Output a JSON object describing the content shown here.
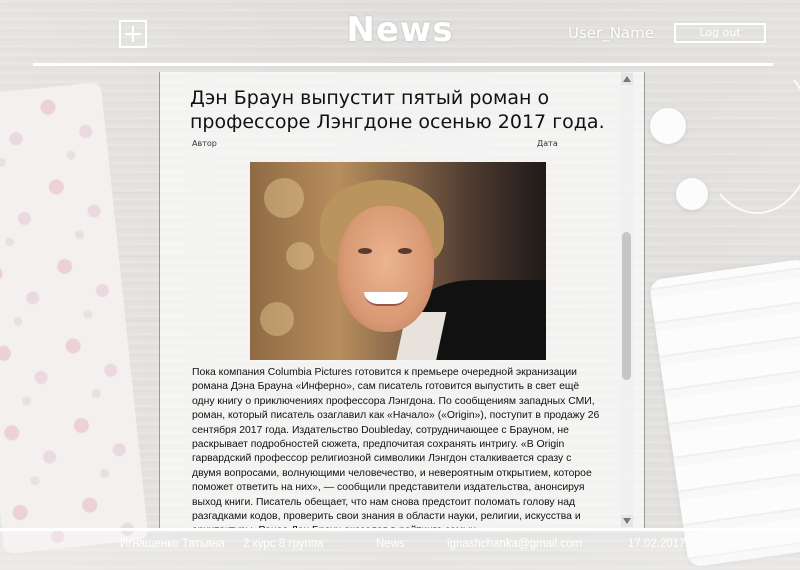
{
  "header": {
    "title": "News",
    "user_name": "User_Name",
    "logout_label": "Log out",
    "add_icon": "plus-square-icon"
  },
  "article": {
    "headline": "Дэн Браун выпустит пятый роман о профессоре Лэнгдоне осенью 2017 года.",
    "author_label": "Автор",
    "date_label": "Дата",
    "body": "Пока компания Columbia Pictures готовится к премьере очередной экранизации романа Дэна Брауна «Инферно», сам писатель готовится выпустить в свет ещё одну книгу о приключениях профессора Лэнгдона. По сообщениям западных СМИ, роман, который писатель озаглавил как «Начало» («Origin»), поступит в продажу 26 сентября 2017 года. Издательство Doubleday, сотрудничающее с Брауном, не раскрывает подробностей сюжета, предпочитая сохранять интригу. «В Origin гарвардский профессор религиозной символики Лэнгдон сталкивается сразу с двумя вопросами, волнующими человечество, и невероятным открытием, которое поможет ответить на них», — сообщили представители издательства, анонсируя выход книги. Писатель обещает, что нам снова предстоит поломать голову над разгадками кодов, проверить свои знания в области науки, религии, искусства и архитектуры. Ранее Дэн Браун оказался в рейтинге самых"
  },
  "footer": {
    "author": "Игнащенко Татьяна",
    "course": "2 курс 8 группа",
    "section": "News",
    "email": "ignashchanka@gmail.com",
    "date": "17.02.2017"
  },
  "colors": {
    "header_text": "#ffffff",
    "body_text": "#111111"
  }
}
